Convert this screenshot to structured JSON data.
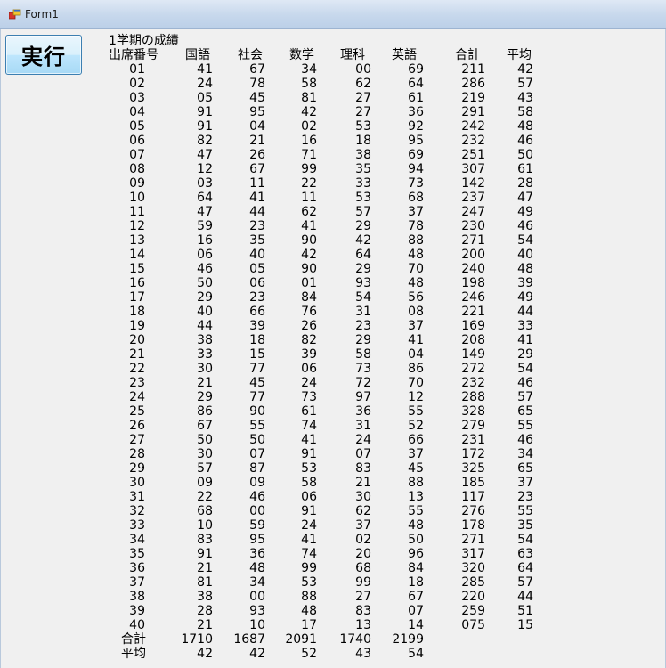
{
  "window": {
    "title": "Form1"
  },
  "toolbar": {
    "run_label": "実行"
  },
  "report": {
    "heading": "1学期の成績",
    "headers": {
      "number": "出席番号",
      "kokugo": "国語",
      "shakai": "社会",
      "sugaku": "数学",
      "rika": "理科",
      "eigo": "英語",
      "total": "合計",
      "average": "平均"
    },
    "rows": [
      [
        "01",
        "41",
        "67",
        "34",
        "00",
        "69",
        "211",
        "42"
      ],
      [
        "02",
        "24",
        "78",
        "58",
        "62",
        "64",
        "286",
        "57"
      ],
      [
        "03",
        "05",
        "45",
        "81",
        "27",
        "61",
        "219",
        "43"
      ],
      [
        "04",
        "91",
        "95",
        "42",
        "27",
        "36",
        "291",
        "58"
      ],
      [
        "05",
        "91",
        "04",
        "02",
        "53",
        "92",
        "242",
        "48"
      ],
      [
        "06",
        "82",
        "21",
        "16",
        "18",
        "95",
        "232",
        "46"
      ],
      [
        "07",
        "47",
        "26",
        "71",
        "38",
        "69",
        "251",
        "50"
      ],
      [
        "08",
        "12",
        "67",
        "99",
        "35",
        "94",
        "307",
        "61"
      ],
      [
        "09",
        "03",
        "11",
        "22",
        "33",
        "73",
        "142",
        "28"
      ],
      [
        "10",
        "64",
        "41",
        "11",
        "53",
        "68",
        "237",
        "47"
      ],
      [
        "11",
        "47",
        "44",
        "62",
        "57",
        "37",
        "247",
        "49"
      ],
      [
        "12",
        "59",
        "23",
        "41",
        "29",
        "78",
        "230",
        "46"
      ],
      [
        "13",
        "16",
        "35",
        "90",
        "42",
        "88",
        "271",
        "54"
      ],
      [
        "14",
        "06",
        "40",
        "42",
        "64",
        "48",
        "200",
        "40"
      ],
      [
        "15",
        "46",
        "05",
        "90",
        "29",
        "70",
        "240",
        "48"
      ],
      [
        "16",
        "50",
        "06",
        "01",
        "93",
        "48",
        "198",
        "39"
      ],
      [
        "17",
        "29",
        "23",
        "84",
        "54",
        "56",
        "246",
        "49"
      ],
      [
        "18",
        "40",
        "66",
        "76",
        "31",
        "08",
        "221",
        "44"
      ],
      [
        "19",
        "44",
        "39",
        "26",
        "23",
        "37",
        "169",
        "33"
      ],
      [
        "20",
        "38",
        "18",
        "82",
        "29",
        "41",
        "208",
        "41"
      ],
      [
        "21",
        "33",
        "15",
        "39",
        "58",
        "04",
        "149",
        "29"
      ],
      [
        "22",
        "30",
        "77",
        "06",
        "73",
        "86",
        "272",
        "54"
      ],
      [
        "23",
        "21",
        "45",
        "24",
        "72",
        "70",
        "232",
        "46"
      ],
      [
        "24",
        "29",
        "77",
        "73",
        "97",
        "12",
        "288",
        "57"
      ],
      [
        "25",
        "86",
        "90",
        "61",
        "36",
        "55",
        "328",
        "65"
      ],
      [
        "26",
        "67",
        "55",
        "74",
        "31",
        "52",
        "279",
        "55"
      ],
      [
        "27",
        "50",
        "50",
        "41",
        "24",
        "66",
        "231",
        "46"
      ],
      [
        "28",
        "30",
        "07",
        "91",
        "07",
        "37",
        "172",
        "34"
      ],
      [
        "29",
        "57",
        "87",
        "53",
        "83",
        "45",
        "325",
        "65"
      ],
      [
        "30",
        "09",
        "09",
        "58",
        "21",
        "88",
        "185",
        "37"
      ],
      [
        "31",
        "22",
        "46",
        "06",
        "30",
        "13",
        "117",
        "23"
      ],
      [
        "32",
        "68",
        "00",
        "91",
        "62",
        "55",
        "276",
        "55"
      ],
      [
        "33",
        "10",
        "59",
        "24",
        "37",
        "48",
        "178",
        "35"
      ],
      [
        "34",
        "83",
        "95",
        "41",
        "02",
        "50",
        "271",
        "54"
      ],
      [
        "35",
        "91",
        "36",
        "74",
        "20",
        "96",
        "317",
        "63"
      ],
      [
        "36",
        "21",
        "48",
        "99",
        "68",
        "84",
        "320",
        "64"
      ],
      [
        "37",
        "81",
        "34",
        "53",
        "99",
        "18",
        "285",
        "57"
      ],
      [
        "38",
        "38",
        "00",
        "88",
        "27",
        "67",
        "220",
        "44"
      ],
      [
        "39",
        "28",
        "93",
        "48",
        "83",
        "07",
        "259",
        "51"
      ],
      [
        "40",
        "21",
        "10",
        "17",
        "13",
        "14",
        "075",
        "15"
      ]
    ],
    "totals": {
      "label": "合計",
      "values": [
        "1710",
        "1687",
        "2091",
        "1740",
        "2199"
      ]
    },
    "averages": {
      "label": "平均",
      "values": [
        "42",
        "42",
        "52",
        "43",
        "54"
      ]
    }
  }
}
